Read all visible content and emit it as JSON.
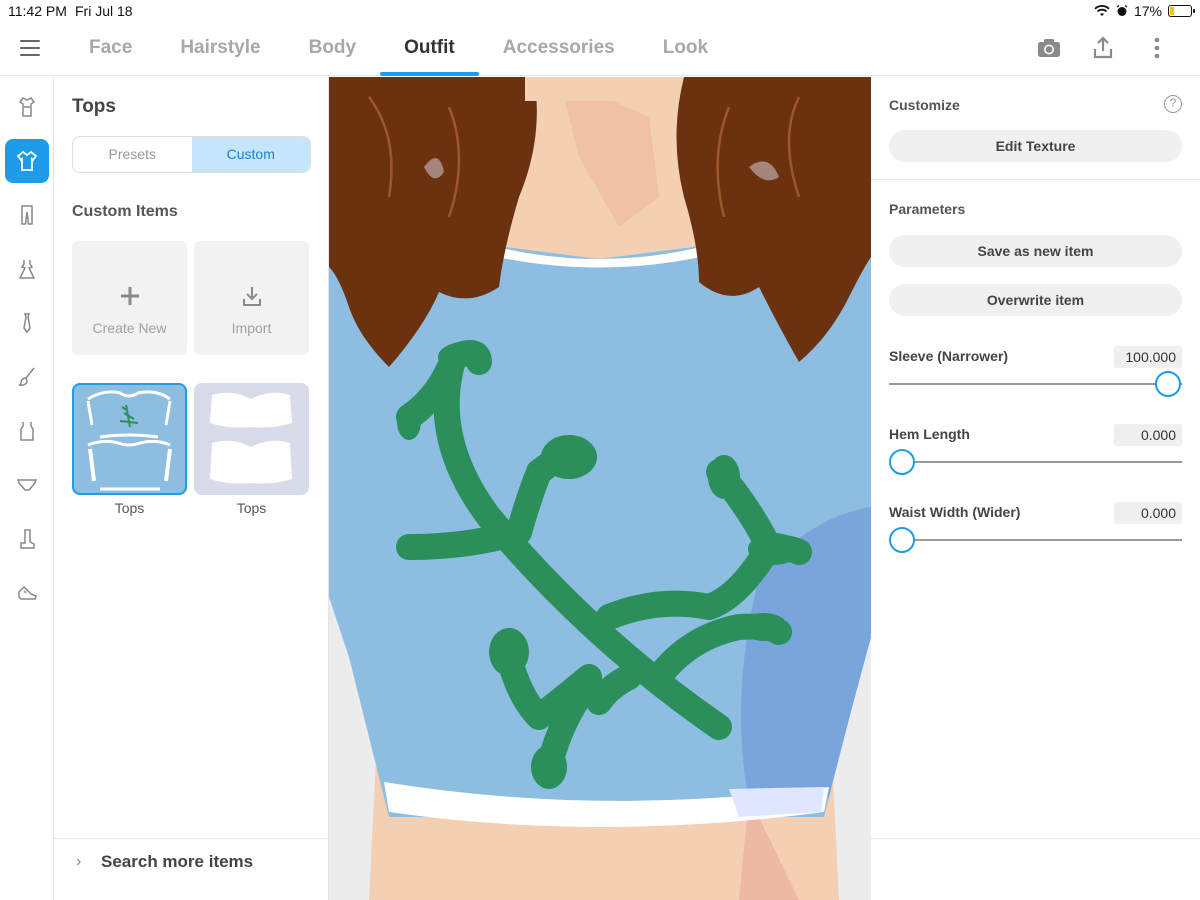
{
  "status": {
    "time": "11:42 PM",
    "date": "Fri Jul 18",
    "battery": "17%"
  },
  "nav": {
    "tabs": [
      {
        "label": "Face"
      },
      {
        "label": "Hairstyle"
      },
      {
        "label": "Body"
      },
      {
        "label": "Outfit"
      },
      {
        "label": "Accessories"
      },
      {
        "label": "Look"
      }
    ],
    "active_tab": "Outfit",
    "actions": [
      "camera-icon",
      "share-icon",
      "more-vertical-icon"
    ]
  },
  "categories": [
    {
      "icon": "full-outfit-icon",
      "active": false
    },
    {
      "icon": "tops-icon",
      "active": true
    },
    {
      "icon": "pants-icon",
      "active": false
    },
    {
      "icon": "dress-icon",
      "active": false
    },
    {
      "icon": "tie-icon",
      "active": false
    },
    {
      "icon": "brush-icon",
      "active": false
    },
    {
      "icon": "vest-icon",
      "active": false
    },
    {
      "icon": "underwear-icon",
      "active": false
    },
    {
      "icon": "boots-icon",
      "active": false
    },
    {
      "icon": "shoe-icon",
      "active": false
    }
  ],
  "items_panel": {
    "title": "Tops",
    "segments": {
      "presets": "Presets",
      "custom": "Custom",
      "selected": "Custom"
    },
    "section_title": "Custom Items",
    "create_new": "Create New",
    "import": "Import",
    "items": [
      {
        "label": "Tops",
        "selected": true
      },
      {
        "label": "Tops",
        "selected": false
      }
    ],
    "search_more": "Search more items"
  },
  "customize": {
    "title": "Customize",
    "edit_texture": "Edit Texture"
  },
  "parameters": {
    "title": "Parameters",
    "save_new": "Save as new item",
    "overwrite": "Overwrite item",
    "sliders": [
      {
        "label": "Sleeve (Narrower)",
        "value": "100.000",
        "level": 1.0
      },
      {
        "label": "Hem Length",
        "value": "0.000",
        "level": 0.0
      },
      {
        "label": "Waist Width (Wider)",
        "value": "0.000",
        "level": 0.0
      }
    ]
  },
  "colors": {
    "accent": "#1e9be9",
    "segment_selected": "#c5e5fa",
    "shirt": "#8dbde0",
    "vine": "#2a8f5a",
    "hair": "#6b3210",
    "skin": "#f2cdb0"
  }
}
